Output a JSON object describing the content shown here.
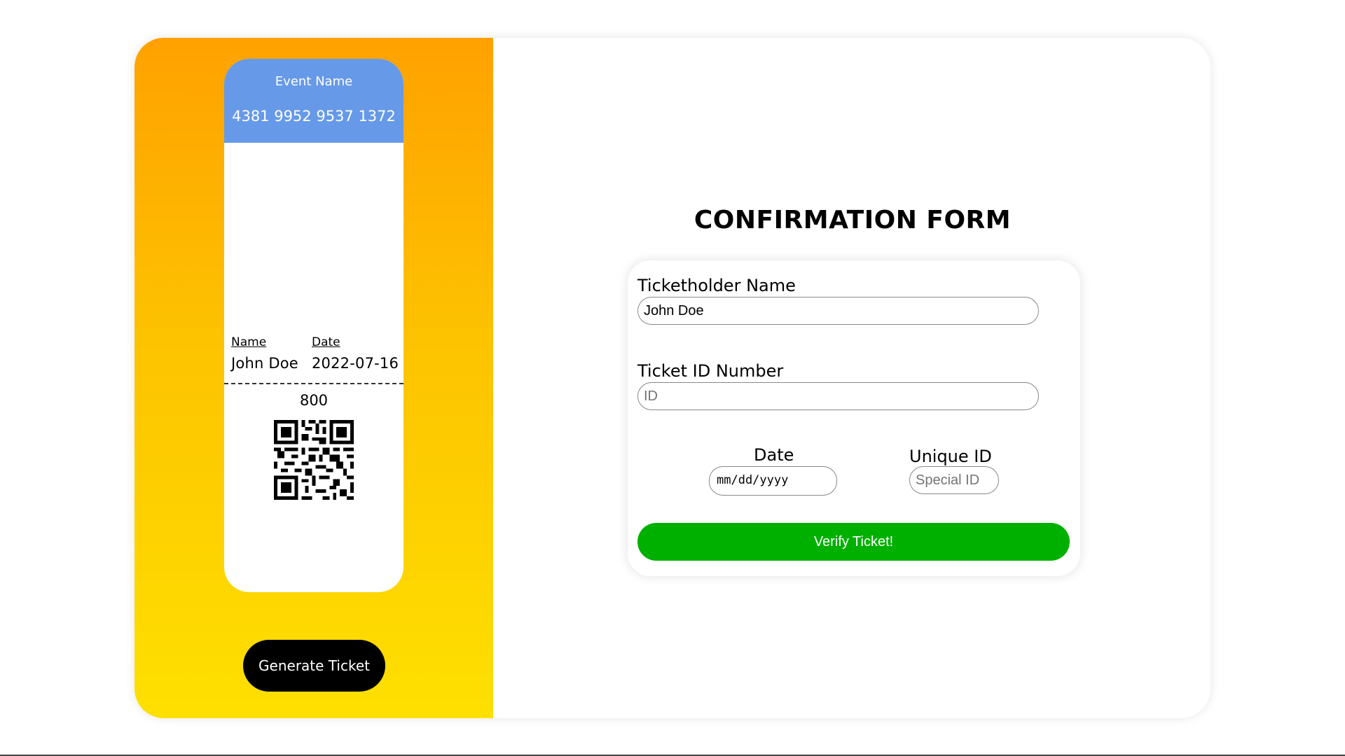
{
  "ticket": {
    "event_name": "Event Name",
    "ticket_number": "4381 9952 9537 1372",
    "name_label": "Name",
    "date_label": "Date",
    "name_value": "John Doe",
    "date_value": "2022-07-16",
    "price": "800"
  },
  "left_panel": {
    "generate_label": "Generate Ticket",
    "gradient_top": "#ffa100",
    "gradient_bottom": "#fee000",
    "header_color": "#6699e8"
  },
  "form": {
    "title": "CONFIRMATION FORM",
    "ticketholder_label": "Ticketholder Name",
    "ticketholder_value": "John Doe",
    "ticket_id_label": "Ticket ID Number",
    "ticket_id_placeholder": "ID",
    "date_label": "Date",
    "date_placeholder": "mm/dd/yyyy",
    "unique_id_label": "Unique ID",
    "unique_id_placeholder": "Special ID",
    "verify_label": "Verify Ticket!",
    "verify_color": "#00b000"
  }
}
